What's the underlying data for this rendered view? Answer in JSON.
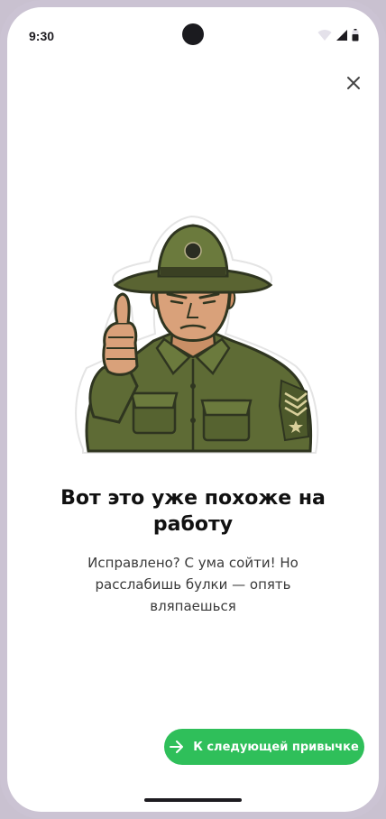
{
  "status_bar": {
    "time": "9:30",
    "icons": [
      "wifi-icon",
      "cellular-signal-icon",
      "battery-icon"
    ]
  },
  "close_icon": "close-icon",
  "illustration": {
    "subject": "drill-sergeant-thumbs-up-sticker",
    "emblem": "eagle-globe-anchor-badge"
  },
  "title": "Вот это уже похоже на работу",
  "message": "Исправлено? С ума сойти! Но расслабишь булки — опять вляпаешься",
  "next_button": {
    "label": "К следующей привычке",
    "icon": "arrow-right-icon",
    "color": "#2fbf5a"
  }
}
